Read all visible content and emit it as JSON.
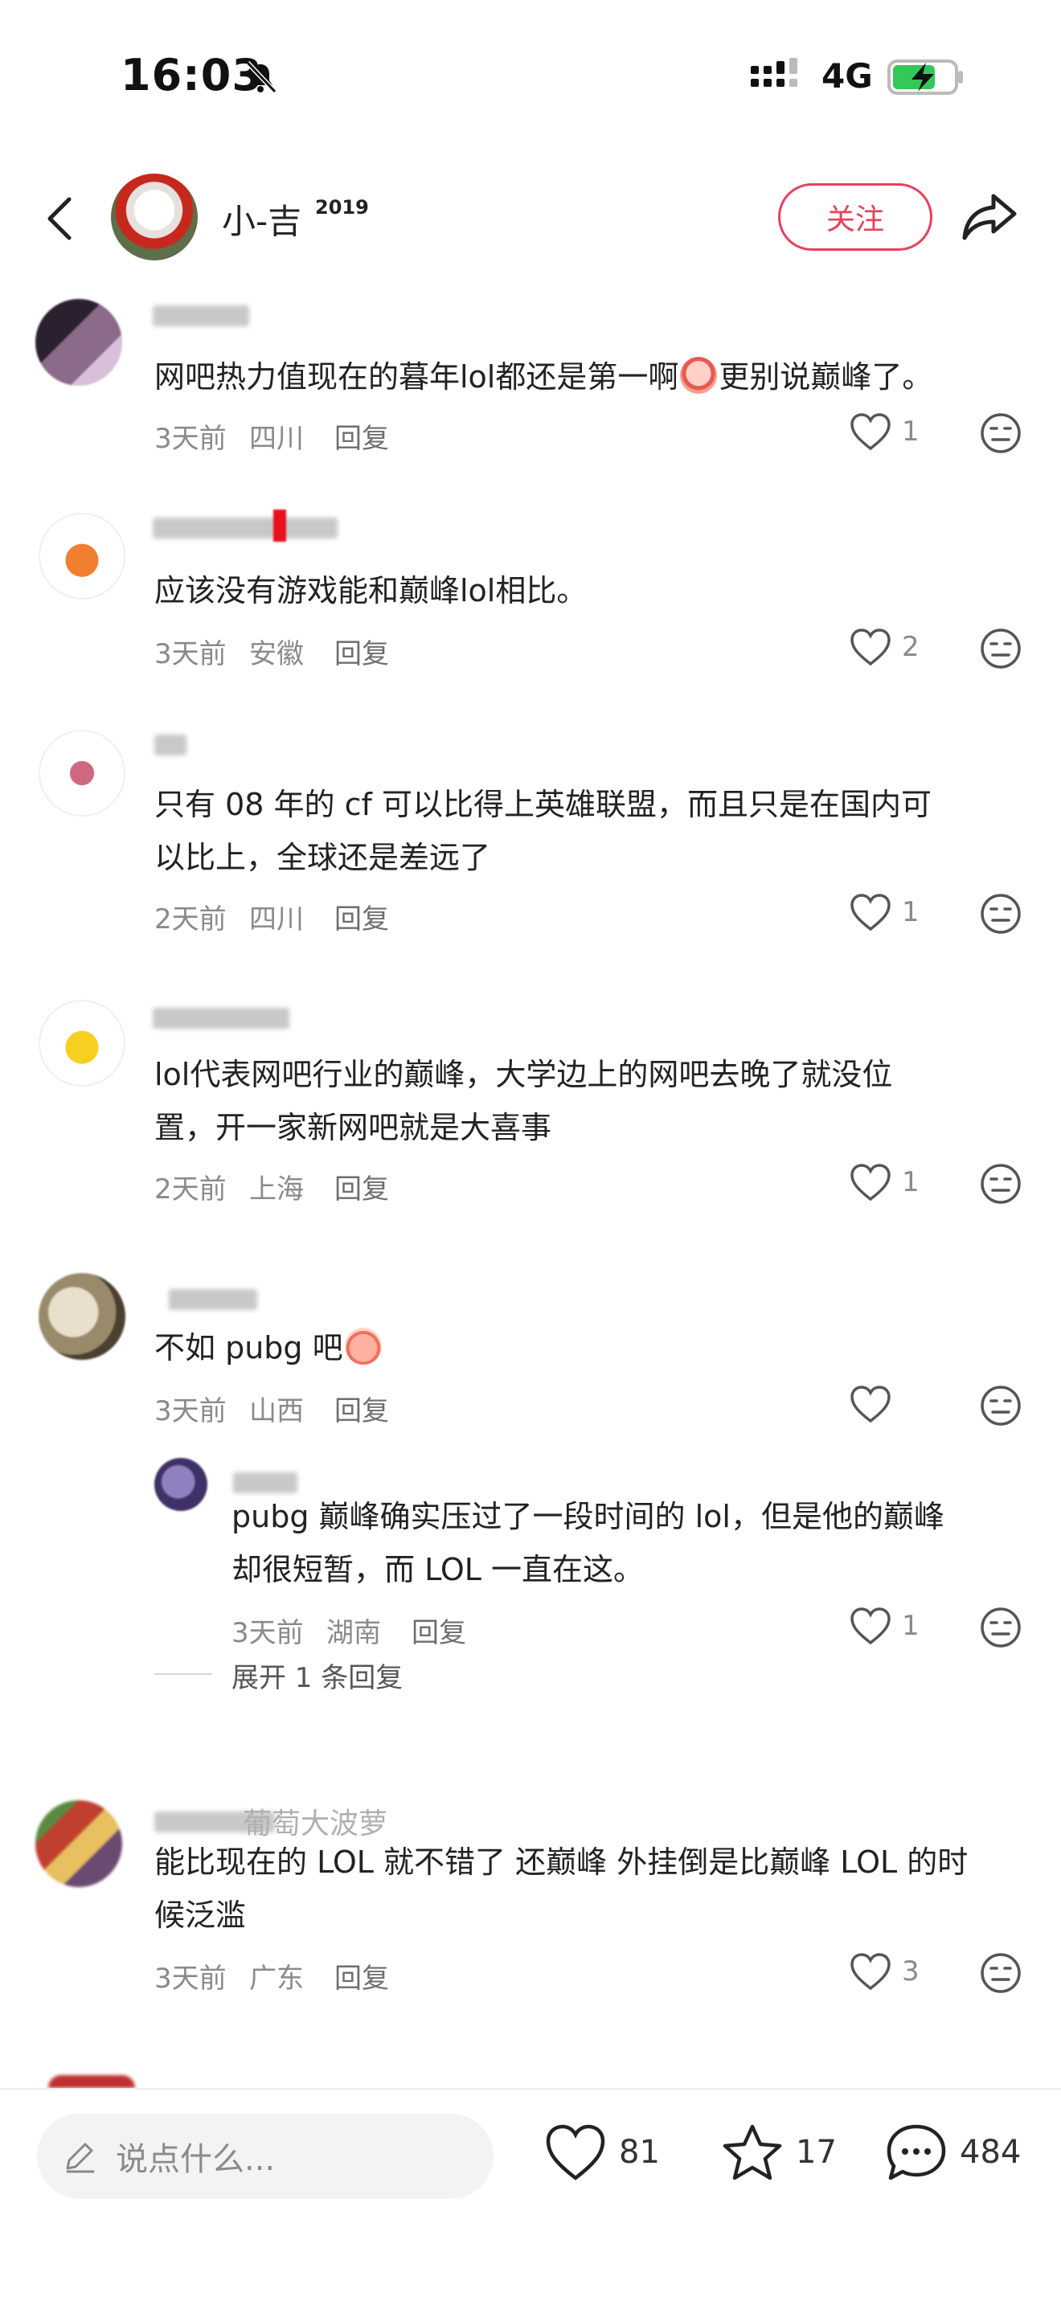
{
  "status_bar": {
    "time": "16:03",
    "network": "4G"
  },
  "header": {
    "username": "小-吉",
    "username_sup": "2019",
    "follow_label": "关注"
  },
  "comments": [
    {
      "text": "网吧热力值现在的暮年lol都还是第一啊",
      "text_after_emoji": "更别说巅峰了。",
      "time": "3天前",
      "location": "四川",
      "reply": "回复",
      "likes": "1"
    },
    {
      "text": "应该没有游戏能和巅峰lol相比。",
      "time": "3天前",
      "location": "安徽",
      "reply": "回复",
      "likes": "2"
    },
    {
      "text_lines": [
        "只有 08 年的 cf 可以比得上英雄联盟，而且只是在国内可",
        "以比上，全球还是差远了"
      ],
      "time": "2天前",
      "location": "四川",
      "reply": "回复",
      "likes": "1"
    },
    {
      "text_lines": [
        "lol代表网吧行业的巅峰，大学边上的网吧去晚了就没位",
        "置，开一家新网吧就是大喜事"
      ],
      "time": "2天前",
      "location": "上海",
      "reply": "回复",
      "likes": "1"
    },
    {
      "text": "不如 pubg 吧",
      "time": "3天前",
      "location": "山西",
      "reply": "回复",
      "likes": ""
    },
    {
      "text_lines": [
        "pubg 巅峰确实压过了一段时间的 lol，但是他的巅峰",
        "却很短暂，而 LOL 一直在这。"
      ],
      "time": "3天前",
      "location": "湖南",
      "reply": "回复",
      "likes": "1",
      "expand": "展开 1 条回复"
    },
    {
      "name_partial": "葡萄大波萝",
      "text_lines": [
        "能比现在的 LOL 就不错了 还巅峰 外挂倒是比巅峰 LOL 的时",
        "候泛滥"
      ],
      "time": "3天前",
      "location": "广东",
      "reply": "回复",
      "likes": "3"
    }
  ],
  "bottom_bar": {
    "placeholder": "说点什么...",
    "likes": "81",
    "stars": "17",
    "comments": "484"
  },
  "colors": {
    "accent": "#e8405a",
    "meta": "#8a8a8a"
  },
  "icons": [
    "bell-off-icon",
    "signal-icon",
    "battery-charging-icon",
    "back-icon",
    "share-icon",
    "heart-icon",
    "dislike-face-icon",
    "pencil-icon",
    "star-icon",
    "chat-bubble-icon"
  ]
}
